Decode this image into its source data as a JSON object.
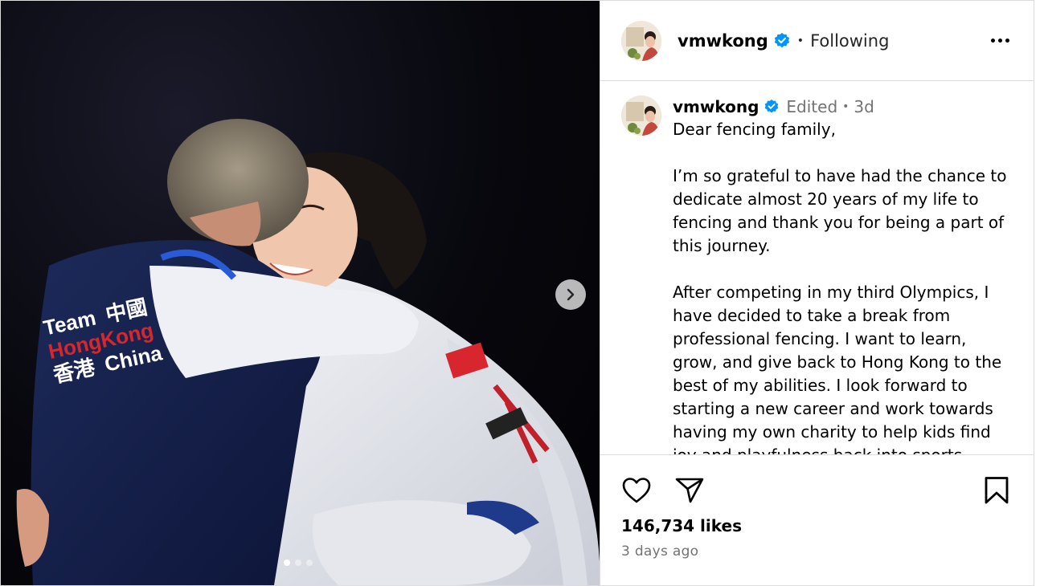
{
  "post": {
    "username": "vmwkong",
    "follow_state": "Following",
    "header_dot": "•",
    "photo_text": {
      "line1a": "Team",
      "line1b": "中國",
      "line2": "HongKong",
      "line3a": "香港",
      "line3b": "China"
    },
    "carousel": {
      "count": 3,
      "active": 1
    },
    "caption": {
      "username": "vmwkong",
      "edited": "Edited",
      "meta_dot": "•",
      "age": "3d",
      "paragraphs": [
        "Dear fencing family,",
        "I’m so grateful to have had the chance to dedicate almost 20 years of my life to fencing and thank you for being a part of this journey.",
        "After competing in my third Olympics, I have decided to take a break from professional fencing. I want to learn, grow, and give back to Hong Kong to the best of my abilities. I look forward to starting a new career and work towards having my own charity to help kids find joy and playfulness back into sports."
      ]
    },
    "likes": "146,734 likes",
    "timestamp": "3 days ago"
  },
  "icons": {
    "verified": "verified-badge-icon",
    "more": "more-options-icon",
    "next": "chevron-right-icon",
    "like": "heart-icon",
    "share": "paper-plane-icon",
    "save": "bookmark-icon"
  },
  "colors": {
    "verified": "#0095f6",
    "border": "#dbdbdb",
    "meta": "#737373"
  }
}
